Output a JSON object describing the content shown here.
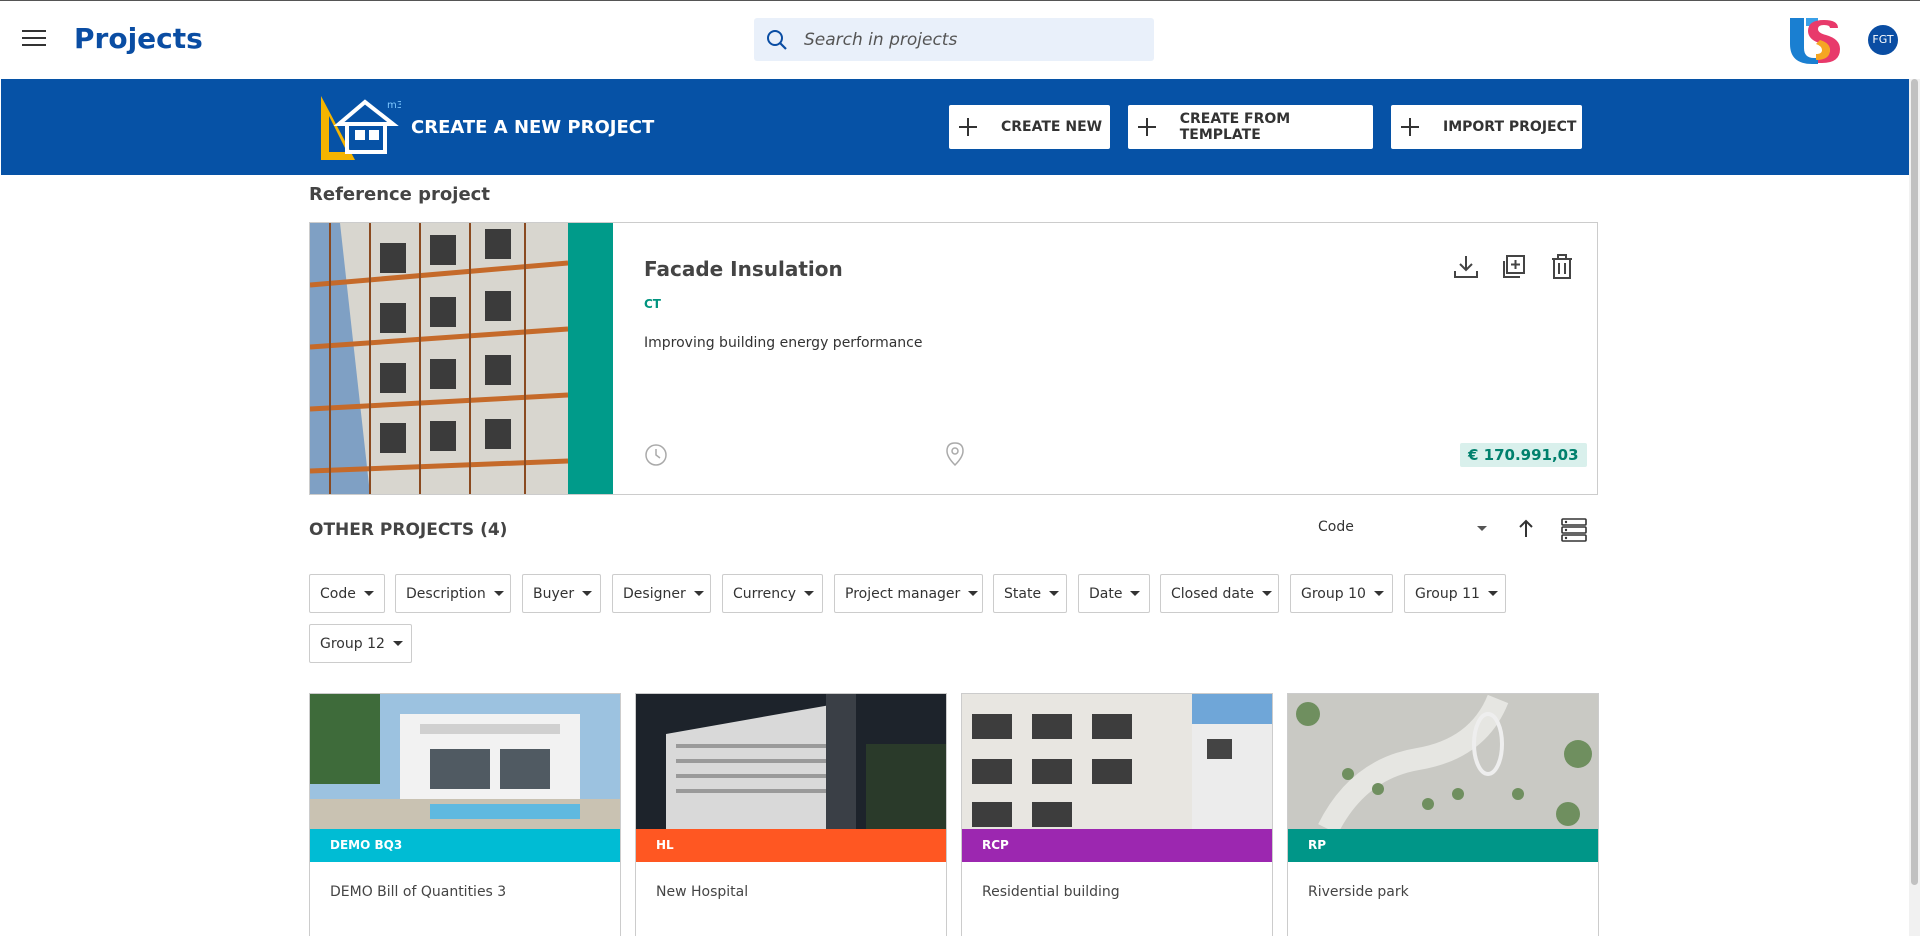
{
  "header": {
    "title": "Projects",
    "search_placeholder": "Search in projects",
    "user_initials": "FGT"
  },
  "banner": {
    "title": "CREATE A NEW PROJECT",
    "buttons": [
      "CREATE NEW",
      "CREATE FROM TEMPLATE",
      "IMPORT PROJECT"
    ]
  },
  "reference": {
    "section_label": "Reference project",
    "title": "Facade Insulation",
    "code": "CT",
    "description": "Improving building energy performance",
    "amount": "€ 170.991,03",
    "actions": [
      "download-icon",
      "duplicate-icon",
      "trash-icon"
    ],
    "strip_color": "#009b8a"
  },
  "other": {
    "title": "OTHER PROJECTS (4)",
    "sort_value": "Code",
    "filters": [
      "Code",
      "Description",
      "Buyer",
      "Designer",
      "Currency",
      "Project manager",
      "State",
      "Date",
      "Closed date",
      "Group 10",
      "Group 11",
      "Group 12"
    ],
    "projects": [
      {
        "code": "DEMO BQ3",
        "name": "DEMO Bill of Quantities 3",
        "color": "#00bcd4"
      },
      {
        "code": "HL",
        "name": "New Hospital",
        "color": "#ff5722"
      },
      {
        "code": "RCP",
        "name": "Residential building",
        "color": "#9c27b0"
      },
      {
        "code": "RP",
        "name": "Riverside park",
        "color": "#009688"
      }
    ]
  },
  "colors": {
    "primary": "#0652a6",
    "title_blue": "#0a4da3"
  }
}
